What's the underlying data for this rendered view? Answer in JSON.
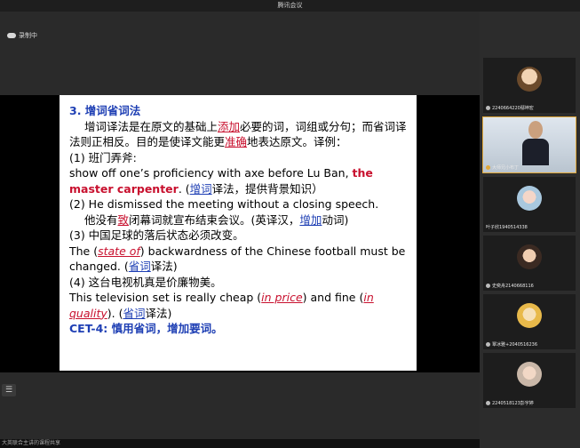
{
  "window": {
    "title": "腾讯会议"
  },
  "recording": {
    "label": "录制中"
  },
  "slide": {
    "heading": "3. 增词省词法",
    "intro": {
      "part1": "增词译法是在原文的基础上",
      "term1": "添加",
      "part2": "必要的词，词组或分句；而省词译法则正相反。目的是使译文能更",
      "term2": "准确",
      "part3": "地表达原文。译例："
    },
    "ex1_cn": "(1) 班门弄斧:",
    "ex1_en": {
      "part1": "show off one’s proficiency with axe before Lu Ban, ",
      "highlight": "the master carpenter",
      "part2": ". (",
      "term": "增词",
      "part3": "译法，提供背景知识）"
    },
    "ex2_en": "(2) He dismissed the meeting without a closing speech.",
    "ex2_cn": {
      "part1": "他没有",
      "term1": "致",
      "part2": "闭幕词就宣布结束会议。(英译汉，",
      "term2": "增加",
      "part3": "动词)"
    },
    "ex3_cn": "(3) 中国足球的落后状态必须改变。",
    "ex3_en": {
      "part1": "The (",
      "phrase": "state of",
      "part2": ") backwardness of the Chinese football must be changed. (",
      "term": "省词",
      "part3": "译法)"
    },
    "ex4_cn": "(4) 这台电视机真是价廉物美。",
    "ex4_en": {
      "part1": "This television set is really cheap (",
      "phrase1": "in price",
      "part2": ") and fine (",
      "phrase2": "in quality",
      "part3": "). (",
      "term": "省词",
      "part4": "译法)"
    },
    "cet": "CET-4: 慎用省词，增加要词。"
  },
  "participants": [
    {
      "name": "2240664220鄢坤宏"
    },
    {
      "name": "大师兄小布丁"
    },
    {
      "name": "叶子欣1940514338"
    },
    {
      "name": "史奕舟2140668116"
    },
    {
      "name": "覃冰雅+2040516236"
    },
    {
      "name": "2240518123彭宇婷"
    }
  ],
  "bottom": {
    "text": "大英联合主讲的课程共享"
  },
  "colors": {
    "accent": "#e0a83a",
    "slide_blue": "#1e3fb4",
    "slide_red": "#c8102e"
  }
}
